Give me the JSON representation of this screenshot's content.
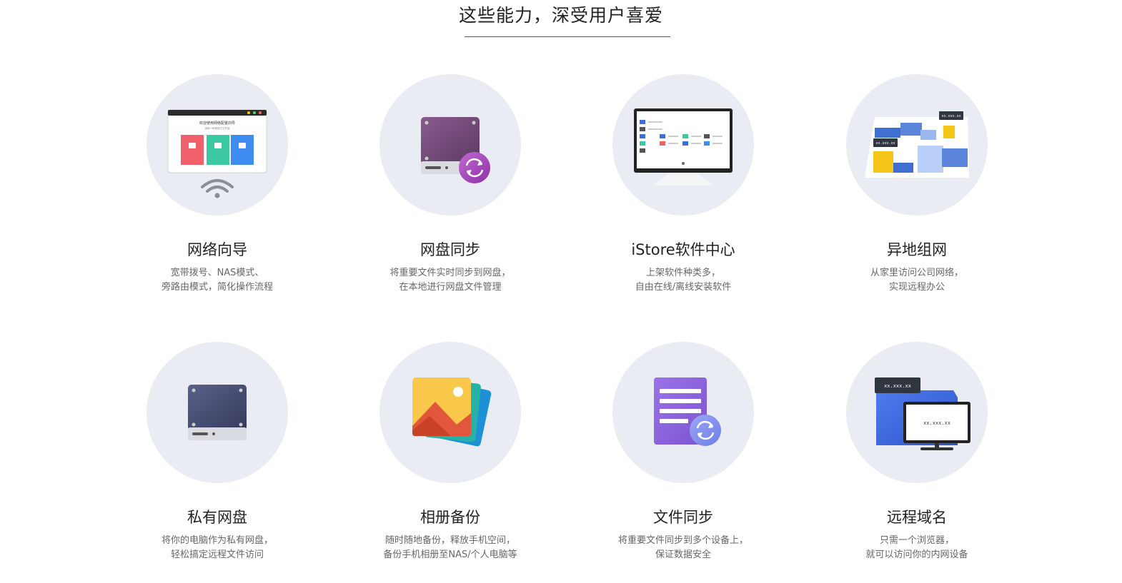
{
  "header": {
    "title": "这些能力，深受用户喜爱"
  },
  "features": [
    {
      "icon": "network-wizard-icon",
      "title": "网络向导",
      "desc": [
        "宽带拨号、NAS模式、",
        "旁路由模式，简化操作流程"
      ]
    },
    {
      "icon": "cloud-drive-sync-icon",
      "title": "网盘同步",
      "desc": [
        "将重要文件实时同步到网盘，",
        "在本地进行网盘文件管理"
      ]
    },
    {
      "icon": "istore-monitor-icon",
      "title": "iStore软件中心",
      "desc": [
        "上架软件种类多，",
        "自由在线/离线安装软件"
      ]
    },
    {
      "icon": "remote-networking-map-icon",
      "title": "异地组网",
      "desc": [
        "从家里访问公司网络，",
        "实现远程办公"
      ]
    },
    {
      "icon": "private-drive-icon",
      "title": "私有网盘",
      "desc": [
        "将你的电脑作为私有网盘，",
        "轻松搞定远程文件访问"
      ]
    },
    {
      "icon": "photo-album-backup-icon",
      "title": "相册备份",
      "desc": [
        "随时随地备份，释放手机空间，",
        "备份手机相册至NAS/个人电脑等"
      ]
    },
    {
      "icon": "file-sync-icon",
      "title": "文件同步",
      "desc": [
        "将重要文件同步到多个设备上，",
        "保证数据安全"
      ]
    },
    {
      "icon": "remote-domain-icon",
      "title": "远程域名",
      "desc": [
        "只需一个浏览器，",
        "就可以访问你的内网设备"
      ]
    }
  ],
  "illustrations": {
    "network_wizard": {
      "window_title": "欢迎使用网络配置向导",
      "window_subtitle": "选择一种常用方式开始"
    },
    "remote_map": {
      "tag_1": "xx.xxx.xx",
      "tag_2": "xx.xxx.xx"
    },
    "remote_domain": {
      "tag": "xx.xxx.xx",
      "screen_text": "xx.xxx.xx"
    }
  },
  "colors": {
    "circle_bg": "#e9ecf2",
    "accent_purple": "#8e44ad",
    "accent_blue": "#3b6fe0",
    "accent_yellow": "#f5c518"
  }
}
